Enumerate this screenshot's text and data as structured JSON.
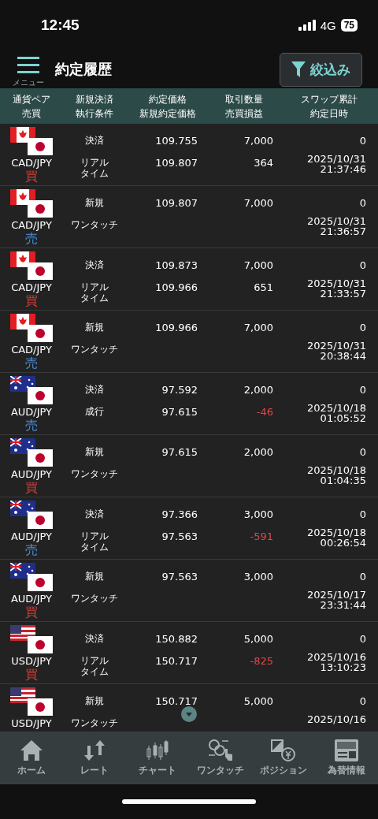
{
  "status_bar": {
    "time": "12:45",
    "network": "4G",
    "battery": "75"
  },
  "header": {
    "menu_label": "メニュー",
    "title": "約定履歴",
    "filter_button": "絞込み"
  },
  "columns": [
    [
      "通貨ペア",
      "売買"
    ],
    [
      "新規決済",
      "執行条件"
    ],
    [
      "約定価格",
      "新規約定価格"
    ],
    [
      "取引数量",
      "売買損益"
    ],
    [
      "スワップ累計",
      "約定日時"
    ]
  ],
  "rows": [
    {
      "kind": "cad",
      "pair": "CAD/JPY",
      "side": {
        "kind": "buy",
        "label": "買"
      },
      "type": "決済",
      "condition": [
        "リアル",
        "タイム"
      ],
      "price": "109.755",
      "open_price": "109.807",
      "quantity": "7,000",
      "pnl": {
        "text": "364",
        "negative": false
      },
      "swap": "0",
      "date": "2025/10/31",
      "time": "21:37:46"
    },
    {
      "kind": "cad",
      "pair": "CAD/JPY",
      "side": {
        "kind": "sell",
        "label": "売"
      },
      "type": "新規",
      "condition": [
        "ワンタッチ"
      ],
      "price": "109.807",
      "quantity": "7,000",
      "swap": "0",
      "date": "2025/10/31",
      "time": "21:36:57"
    },
    {
      "kind": "cad",
      "pair": "CAD/JPY",
      "side": {
        "kind": "buy",
        "label": "買"
      },
      "type": "決済",
      "condition": [
        "リアル",
        "タイム"
      ],
      "price": "109.873",
      "open_price": "109.966",
      "quantity": "7,000",
      "pnl": {
        "text": "651",
        "negative": false
      },
      "swap": "0",
      "date": "2025/10/31",
      "time": "21:33:57"
    },
    {
      "kind": "cad",
      "pair": "CAD/JPY",
      "side": {
        "kind": "sell",
        "label": "売"
      },
      "type": "新規",
      "condition": [
        "ワンタッチ"
      ],
      "price": "109.966",
      "quantity": "7,000",
      "swap": "0",
      "date": "2025/10/31",
      "time": "20:38:44"
    },
    {
      "kind": "aud",
      "pair": "AUD/JPY",
      "side": {
        "kind": "sell",
        "label": "売"
      },
      "type": "決済",
      "condition": [
        "成行"
      ],
      "price": "97.592",
      "open_price": "97.615",
      "quantity": "2,000",
      "pnl": {
        "text": "-46",
        "negative": true
      },
      "swap": "0",
      "date": "2025/10/18",
      "time": "01:05:52"
    },
    {
      "kind": "aud",
      "pair": "AUD/JPY",
      "side": {
        "kind": "buy",
        "label": "買"
      },
      "type": "新規",
      "condition": [
        "ワンタッチ"
      ],
      "price": "97.615",
      "quantity": "2,000",
      "swap": "0",
      "date": "2025/10/18",
      "time": "01:04:35"
    },
    {
      "kind": "aud",
      "pair": "AUD/JPY",
      "side": {
        "kind": "sell",
        "label": "売"
      },
      "type": "決済",
      "condition": [
        "リアル",
        "タイム"
      ],
      "price": "97.366",
      "open_price": "97.563",
      "quantity": "3,000",
      "pnl": {
        "text": "-591",
        "negative": true
      },
      "swap": "0",
      "date": "2025/10/18",
      "time": "00:26:54"
    },
    {
      "kind": "aud",
      "pair": "AUD/JPY",
      "side": {
        "kind": "buy",
        "label": "買"
      },
      "type": "新規",
      "condition": [
        "ワンタッチ"
      ],
      "price": "97.563",
      "quantity": "3,000",
      "swap": "0",
      "date": "2025/10/17",
      "time": "23:31:44"
    },
    {
      "kind": "usd",
      "pair": "USD/JPY",
      "side": {
        "kind": "buy",
        "label": "買"
      },
      "type": "決済",
      "condition": [
        "リアル",
        "タイム"
      ],
      "price": "150.882",
      "open_price": "150.717",
      "quantity": "5,000",
      "pnl": {
        "text": "-825",
        "negative": true
      },
      "swap": "0",
      "date": "2025/10/16",
      "time": "13:10:23"
    },
    {
      "kind": "usd",
      "pair": "USD/JPY",
      "type": "新規",
      "condition": [
        "ワンタッチ"
      ],
      "price": "150.717",
      "quantity": "5,000",
      "swap": "0",
      "date": "2025/10/16"
    }
  ],
  "tabs": [
    {
      "kind": "home",
      "label": "ホーム"
    },
    {
      "kind": "rate",
      "label": "レート"
    },
    {
      "kind": "chart",
      "label": "チャート"
    },
    {
      "kind": "onetouch",
      "label": "ワンタッチ"
    },
    {
      "kind": "position",
      "label": "ポジション"
    },
    {
      "kind": "news",
      "label": "為替情報"
    }
  ]
}
